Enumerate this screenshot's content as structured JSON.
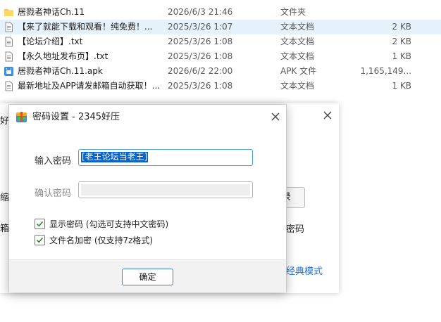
{
  "files": [
    {
      "name": "居戮者神话Ch.11",
      "date": "2026/6/3 21:46",
      "type": "文件夹",
      "size": "",
      "icon": "folder-icon",
      "selected": false
    },
    {
      "name": "【来了就能下载和观看！纯免费！...",
      "date": "2025/3/26 1:07",
      "type": "文本文档",
      "size": "2 KB",
      "icon": "text-file-icon",
      "selected": true
    },
    {
      "name": "【论坛介绍】.txt",
      "date": "2025/3/26 1:08",
      "type": "文本文档",
      "size": "2 KB",
      "icon": "text-file-icon",
      "selected": false
    },
    {
      "name": "【永久地址发布页】.txt",
      "date": "2025/3/26 1:08",
      "type": "文本文档",
      "size": "1 KB",
      "icon": "text-file-icon",
      "selected": false
    },
    {
      "name": "居戮者神话Ch.11.apk",
      "date": "2026/6/2 22:00",
      "type": "APK 文件",
      "size": "1,165,149...",
      "icon": "apk-file-icon",
      "selected": false
    },
    {
      "name": "最新地址及APP请发邮箱自动获取！...",
      "date": "2025/3/26 1:08",
      "type": "文本文档",
      "size": "1 KB",
      "icon": "text-file-icon",
      "selected": false
    }
  ],
  "background_window": {
    "side_fragment_top": "好",
    "side_fragment_mid": "缩",
    "side_fragment_low": "箱",
    "button_fragment": "录",
    "password_label_fragment": "密码",
    "link_text": "经典模式"
  },
  "dialog": {
    "title": "密码设置 - 2345好压",
    "password_label": "输入密码",
    "password_value": "[老王论坛当老王]",
    "confirm_label": "确认密码",
    "confirm_value": "",
    "show_password_label": "显示密码 (勾选可支持中文密码)",
    "show_password_checked": true,
    "encrypt_names_label": "文件名加密 (仅支持7z格式)",
    "encrypt_names_checked": true,
    "ok_label": "确定"
  },
  "colors": {
    "selection": "#0a63c9",
    "row_highlight": "#e5f1fb",
    "link": "#1f6fd1",
    "input_focus": "#4aa3df",
    "check": "#2e8b2e"
  }
}
